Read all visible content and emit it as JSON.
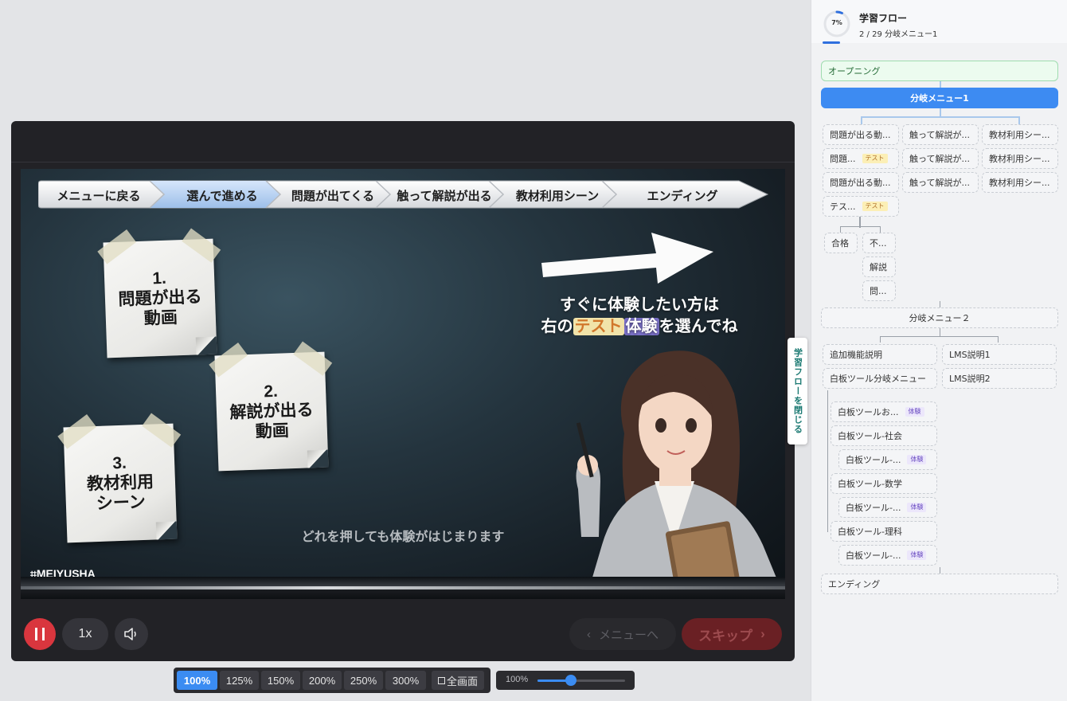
{
  "colors": {
    "accent": "#3d8bf2",
    "pause": "#d9363e",
    "skip": "#6a2024",
    "test_badge": "#fcefb6",
    "try_badge": "#ece7fb"
  },
  "video": {
    "breadcrumbs": [
      "メニューに戻る",
      "選んで進める",
      "問題が出てくる",
      "触って解説が出る",
      "教材利用シーン",
      "エンディング"
    ],
    "active_breadcrumb": 1,
    "notes": [
      {
        "text": "1.\n問題が出る\n動画"
      },
      {
        "text": "2.\n解説が出る\n動画"
      },
      {
        "text": "3.\n教材利用\nシーン"
      }
    ],
    "cta_line1": "すぐに体験したい方は",
    "cta_prefix": "右の",
    "cta_test": "テスト",
    "cta_try": "体験",
    "cta_suffix": "を選んでね",
    "hint": "どれを押しても体験がはじまります",
    "watermark": "⌗MEIYUSHA"
  },
  "controls": {
    "pause_icon": "pause-icon",
    "speed": "1x",
    "volume_icon": "volume-icon",
    "menu_label": "メニューへ",
    "skip_label": "スキップ"
  },
  "zoom": {
    "options": [
      "100%",
      "125%",
      "150%",
      "200%",
      "250%",
      "300%"
    ],
    "selected": "100%",
    "fullscreen_label": "全画面",
    "slider_label": "100%",
    "slider_level": 0.38
  },
  "flow_tab_label": "学習フローを閉じる",
  "flow": {
    "progress_pct": "7%",
    "progress_fraction": 0.07,
    "title": "学習フロー",
    "subtitle": "2 / 29 分岐メニュー1",
    "opening": "オープニング",
    "branch1": "分岐メニュー1",
    "b1_col1": [
      "問題が出る動...",
      "問題...",
      "問題が出る動...",
      "テス..."
    ],
    "b1_col1_badges": [
      "",
      "テスト",
      "",
      "テスト"
    ],
    "b1_col2": [
      "触って解説が...",
      "触って解説が...",
      "触って解説が..."
    ],
    "b1_col3": [
      "教材利用シー...",
      "教材利用シー...",
      "教材利用シー..."
    ],
    "result_pass": "合格",
    "result_fail": [
      "不...",
      "解説",
      "問..."
    ],
    "branch2": "分岐メニュー２",
    "b2_left": [
      "追加機能説明",
      "白板ツール分岐メニュー"
    ],
    "b2_right": [
      "LMS説明1",
      "LMS説明2"
    ],
    "whiteboard_items": [
      {
        "label": "白板ツールお...",
        "badge": "体験"
      },
      {
        "label": "白板ツール-社会",
        "badge": ""
      },
      {
        "label": "白板ツール-...",
        "badge": "体験"
      },
      {
        "label": "白板ツール-数学",
        "badge": ""
      },
      {
        "label": "白板ツール-...",
        "badge": "体験"
      },
      {
        "label": "白板ツール-理科",
        "badge": ""
      },
      {
        "label": "白板ツール-...",
        "badge": "体験"
      }
    ],
    "ending": "エンディング"
  }
}
